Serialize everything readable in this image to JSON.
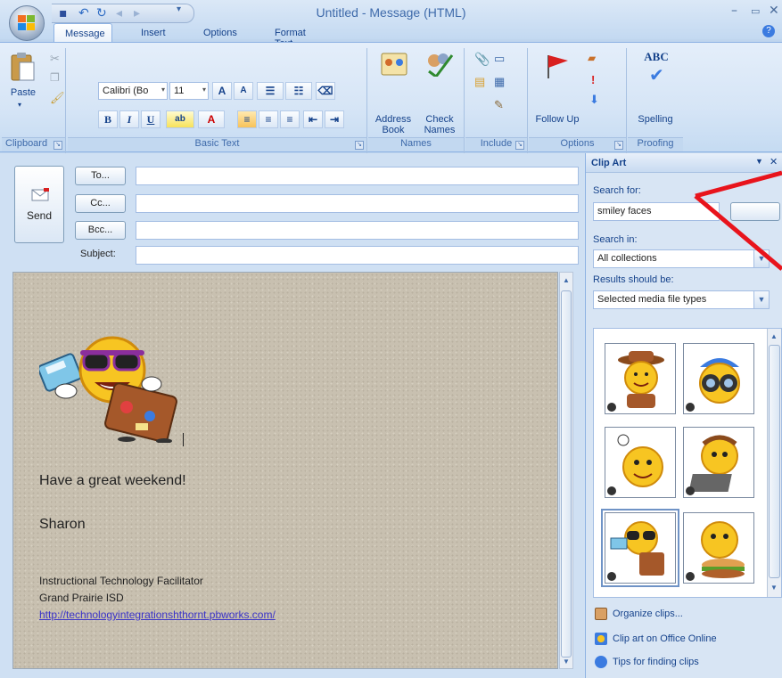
{
  "window": {
    "title": "Untitled - Message (HTML)"
  },
  "tabs": [
    "Message",
    "Insert",
    "Options",
    "Format Text"
  ],
  "ribbon": {
    "clipboard": {
      "paste": "Paste",
      "label": "Clipboard"
    },
    "basic_text": {
      "font": "Calibri (Bo",
      "size": "11",
      "bold": "B",
      "italic": "I",
      "underline": "U",
      "label": "Basic Text"
    },
    "names": {
      "address_book": "Address Book",
      "check_names": "Check Names",
      "label": "Names"
    },
    "include": {
      "label": "Include"
    },
    "options": {
      "follow_up": "Follow Up",
      "label": "Options"
    },
    "proofing": {
      "spelling": "Spelling",
      "abc": "ABC",
      "label": "Proofing"
    }
  },
  "compose": {
    "send": "Send",
    "to": "To...",
    "cc": "Cc...",
    "bcc": "Bcc...",
    "subject": "Subject:",
    "body": {
      "greeting": "Have a great weekend!",
      "name": "Sharon",
      "title": "Instructional Technology Facilitator",
      "org": "Grand Prairie ISD",
      "link": "http://technologyintegrationshthornt.pbworks.com/"
    }
  },
  "clip_art": {
    "title": "Clip Art",
    "search_for_label": "Search for:",
    "search_value": "smiley faces",
    "search_in_label": "Search in:",
    "search_in_value": "All collections",
    "results_label": "Results should be:",
    "results_value": "Selected media file types",
    "links": [
      "Organize clips...",
      "Clip art on Office Online",
      "Tips for finding clips"
    ]
  },
  "colors": {
    "annotation_arrow": "#e8141c",
    "ribbon_bg": "#d6e5f6",
    "pane_bg": "#d8e5f4"
  }
}
